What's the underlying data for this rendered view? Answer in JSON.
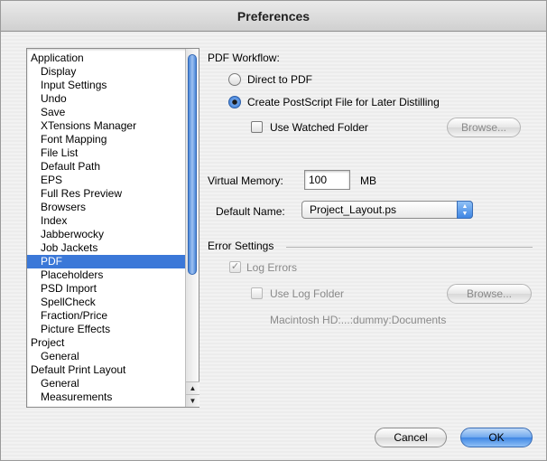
{
  "window": {
    "title": "Preferences"
  },
  "sidebar": {
    "items": [
      {
        "label": "Application",
        "level": 0
      },
      {
        "label": "Display",
        "level": 1
      },
      {
        "label": "Input Settings",
        "level": 1
      },
      {
        "label": "Undo",
        "level": 1
      },
      {
        "label": "Save",
        "level": 1
      },
      {
        "label": "XTensions Manager",
        "level": 1
      },
      {
        "label": "Font Mapping",
        "level": 1
      },
      {
        "label": "File List",
        "level": 1
      },
      {
        "label": "Default Path",
        "level": 1
      },
      {
        "label": "EPS",
        "level": 1
      },
      {
        "label": "Full Res Preview",
        "level": 1
      },
      {
        "label": "Browsers",
        "level": 1
      },
      {
        "label": "Index",
        "level": 1
      },
      {
        "label": "Jabberwocky",
        "level": 1
      },
      {
        "label": "Job Jackets",
        "level": 1
      },
      {
        "label": "PDF",
        "level": 1,
        "selected": true
      },
      {
        "label": "Placeholders",
        "level": 1
      },
      {
        "label": "PSD Import",
        "level": 1
      },
      {
        "label": "SpellCheck",
        "level": 1
      },
      {
        "label": "Fraction/Price",
        "level": 1
      },
      {
        "label": "Picture Effects",
        "level": 1
      },
      {
        "label": "Project",
        "level": 0
      },
      {
        "label": "General",
        "level": 1
      },
      {
        "label": "Default Print Layout",
        "level": 0
      },
      {
        "label": "General",
        "level": 1
      },
      {
        "label": "Measurements",
        "level": 1
      }
    ],
    "selected_color": "#3b78d8"
  },
  "pdf": {
    "workflow_label": "PDF Workflow:",
    "direct_label": "Direct to PDF",
    "postscript_label": "Create PostScript File for Later Distilling",
    "watched_folder_label": "Use Watched Folder",
    "browse_label": "Browse...",
    "virtual_memory_label": "Virtual Memory:",
    "virtual_memory_value": "100",
    "virtual_memory_unit": "MB",
    "default_name_label": "Default Name:",
    "default_name_value": "Project_Layout.ps"
  },
  "errors": {
    "group_label": "Error Settings",
    "log_errors_label": "Log Errors",
    "log_folder_label": "Use Log Folder",
    "browse_label": "Browse...",
    "path": "Macintosh HD:...:dummy:Documents"
  },
  "footer": {
    "cancel_label": "Cancel",
    "ok_label": "OK"
  },
  "colors": {
    "accent": "#3f86e4"
  }
}
